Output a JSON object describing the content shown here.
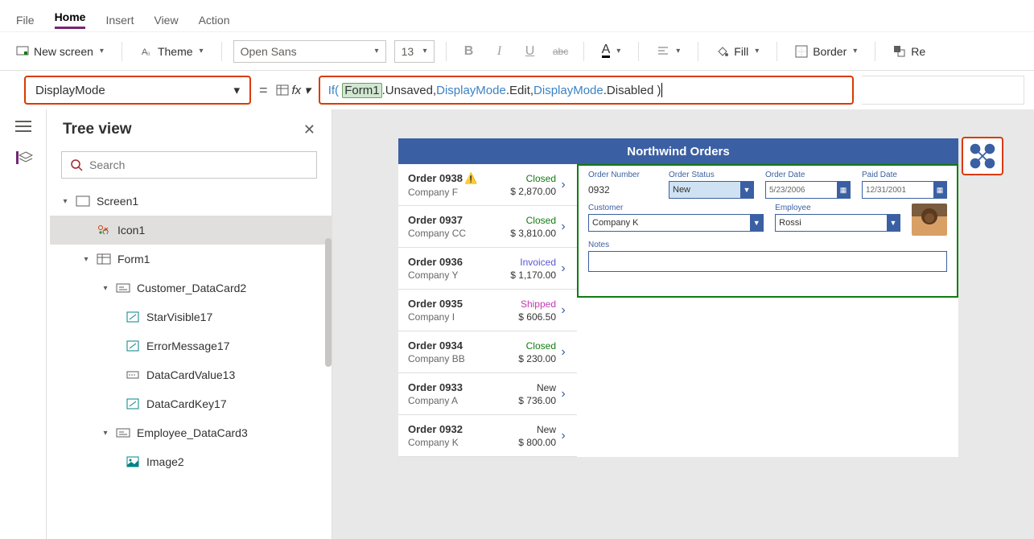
{
  "menu": {
    "file": "File",
    "home": "Home",
    "insert": "Insert",
    "view": "View",
    "action": "Action"
  },
  "ribbon": {
    "newscreen": "New screen",
    "theme": "Theme",
    "font": "Open Sans",
    "fontsize": "13",
    "fill": "Fill",
    "border": "Border",
    "reorder": "Re"
  },
  "formula": {
    "property": "DisplayMode",
    "tokens": {
      "if": "If(",
      "form": "Form1",
      "unsaved": ".Unsaved, ",
      "dm1": "DisplayMode",
      "edit": ".Edit, ",
      "dm2": "DisplayMode",
      "disabled": ".Disabled )"
    }
  },
  "tree": {
    "title": "Tree view",
    "search_placeholder": "Search",
    "items": {
      "screen1": "Screen1",
      "icon1": "Icon1",
      "form1": "Form1",
      "custcard": "Customer_DataCard2",
      "starvis": "StarVisible17",
      "errmsg": "ErrorMessage17",
      "dcv": "DataCardValue13",
      "dck": "DataCardKey17",
      "empcard": "Employee_DataCard3",
      "image2": "Image2"
    }
  },
  "app": {
    "title": "Northwind Orders",
    "orders": [
      {
        "num": "Order 0938",
        "warn": true,
        "company": "Company F",
        "status": "Closed",
        "statusCls": "closed",
        "amount": "$ 2,870.00"
      },
      {
        "num": "Order 0937",
        "company": "Company CC",
        "status": "Closed",
        "statusCls": "closed",
        "amount": "$ 3,810.00"
      },
      {
        "num": "Order 0936",
        "company": "Company Y",
        "status": "Invoiced",
        "statusCls": "invoiced",
        "amount": "$ 1,170.00"
      },
      {
        "num": "Order 0935",
        "company": "Company I",
        "status": "Shipped",
        "statusCls": "shipped",
        "amount": "$ 606.50"
      },
      {
        "num": "Order 0934",
        "company": "Company BB",
        "status": "Closed",
        "statusCls": "closed",
        "amount": "$ 230.00"
      },
      {
        "num": "Order 0933",
        "company": "Company A",
        "status": "New",
        "statusCls": "new",
        "amount": "$ 736.00"
      },
      {
        "num": "Order 0932",
        "company": "Company K",
        "status": "New",
        "statusCls": "new",
        "amount": "$ 800.00"
      }
    ],
    "form": {
      "labels": {
        "ordernum": "Order Number",
        "orderstatus": "Order Status",
        "orderdate": "Order Date",
        "paiddate": "Paid Date",
        "customer": "Customer",
        "employee": "Employee",
        "notes": "Notes"
      },
      "values": {
        "ordernum": "0932",
        "orderstatus": "New",
        "orderdate": "5/23/2006",
        "paiddate": "12/31/2001",
        "customer": "Company K",
        "employee": "Rossi"
      }
    }
  }
}
